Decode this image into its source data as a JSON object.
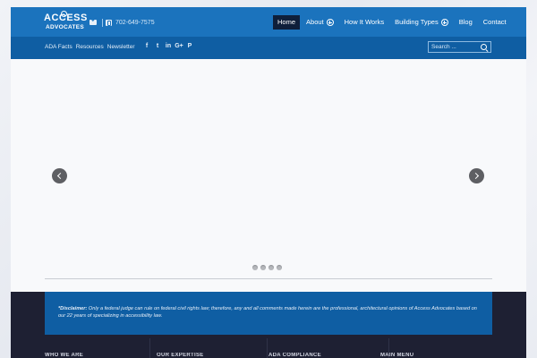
{
  "logo": {
    "line1": "ACCESS",
    "line2": "ADVOCATES"
  },
  "contact": {
    "phone": "702-649-7575"
  },
  "nav": {
    "items": [
      {
        "label": "Home",
        "active": true,
        "submenu": false
      },
      {
        "label": "About",
        "active": false,
        "submenu": true
      },
      {
        "label": "How It Works",
        "active": false,
        "submenu": false
      },
      {
        "label": "Building Types",
        "active": false,
        "submenu": true
      },
      {
        "label": "Blog",
        "active": false,
        "submenu": false
      },
      {
        "label": "Contact",
        "active": false,
        "submenu": false
      }
    ]
  },
  "subnav": {
    "links": [
      "ADA Facts",
      "Resources",
      "Newsletter"
    ],
    "socials": [
      {
        "icon": "facebook-icon",
        "glyph": "f"
      },
      {
        "icon": "twitter-icon",
        "glyph": "t"
      },
      {
        "icon": "linkedin-icon",
        "glyph": "in"
      },
      {
        "icon": "google-plus-icon",
        "glyph": "G+"
      },
      {
        "icon": "pinterest-icon",
        "glyph": "P"
      }
    ]
  },
  "search": {
    "placeholder": "Search ..."
  },
  "slider": {
    "dot_count": 4
  },
  "footer": {
    "disclaimer_label": "*Disclaimer:",
    "disclaimer_text": " Only a federal judge can rule on federal civil rights law; therefore, any and all comments made herein are the professional,  architectural opinions of Access Advocates based on our 22 years of specializing in accessibility law.",
    "columns": [
      "WHO WE ARE",
      "OUR EXPERTISE",
      "ADA COMPLIANCE",
      "MAIN MENU"
    ]
  },
  "colors": {
    "header": "#1b73bd",
    "subbar": "#0f5ea3",
    "footer": "#1e2033",
    "active_nav": "#0f1f3a"
  }
}
